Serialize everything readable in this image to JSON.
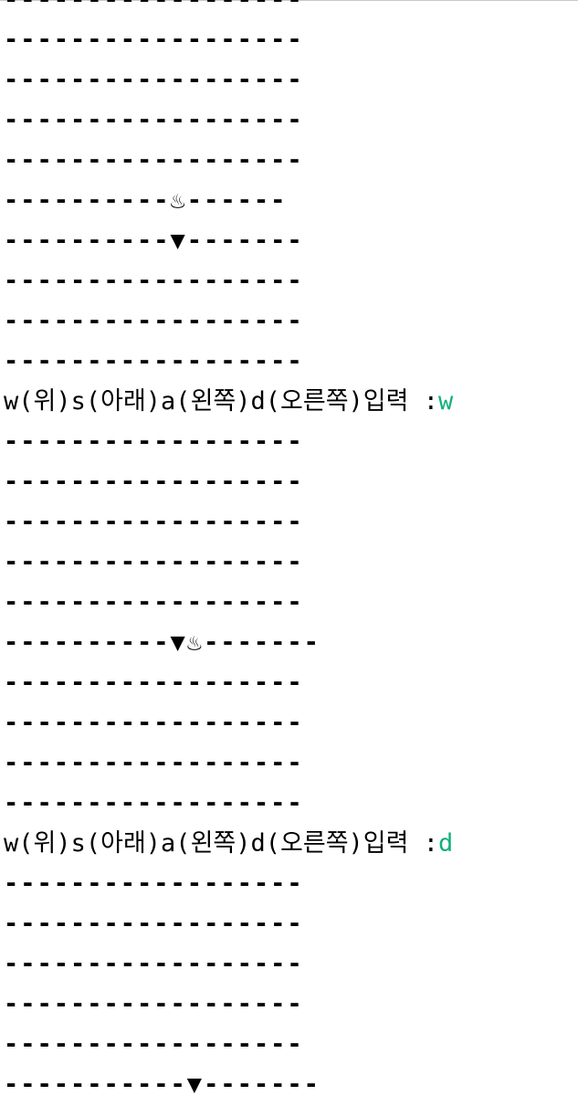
{
  "console": {
    "lines": [
      {
        "type": "row",
        "text": "------------------"
      },
      {
        "type": "row",
        "text": "------------------"
      },
      {
        "type": "row",
        "text": "------------------"
      },
      {
        "type": "row",
        "text": "------------------"
      },
      {
        "type": "row",
        "text": "------------------"
      },
      {
        "type": "row",
        "text": "----------♨------"
      },
      {
        "type": "row",
        "text": "----------▼-------"
      },
      {
        "type": "row",
        "text": "------------------"
      },
      {
        "type": "row",
        "text": "------------------"
      },
      {
        "type": "row",
        "text": "------------------"
      },
      {
        "type": "prompt",
        "text": "w(위)s(아래)a(왼쪽)d(오른쪽)입력 :",
        "input": "w"
      },
      {
        "type": "row",
        "text": "------------------"
      },
      {
        "type": "row",
        "text": "------------------"
      },
      {
        "type": "row",
        "text": "------------------"
      },
      {
        "type": "row",
        "text": "------------------"
      },
      {
        "type": "row",
        "text": "------------------"
      },
      {
        "type": "row",
        "text": "----------▼♨-------"
      },
      {
        "type": "row",
        "text": "------------------"
      },
      {
        "type": "row",
        "text": "------------------"
      },
      {
        "type": "row",
        "text": "------------------"
      },
      {
        "type": "row",
        "text": "------------------"
      },
      {
        "type": "prompt",
        "text": "w(위)s(아래)a(왼쪽)d(오른쪽)입력 :",
        "input": "d"
      },
      {
        "type": "row",
        "text": "------------------"
      },
      {
        "type": "row",
        "text": "------------------"
      },
      {
        "type": "row",
        "text": "------------------"
      },
      {
        "type": "row",
        "text": "------------------"
      },
      {
        "type": "row",
        "text": "------------------"
      },
      {
        "type": "row",
        "text": "-----------▼-------"
      }
    ]
  },
  "colors": {
    "text": "#000000",
    "input_echo": "#13b07a",
    "background": "#ffffff"
  }
}
